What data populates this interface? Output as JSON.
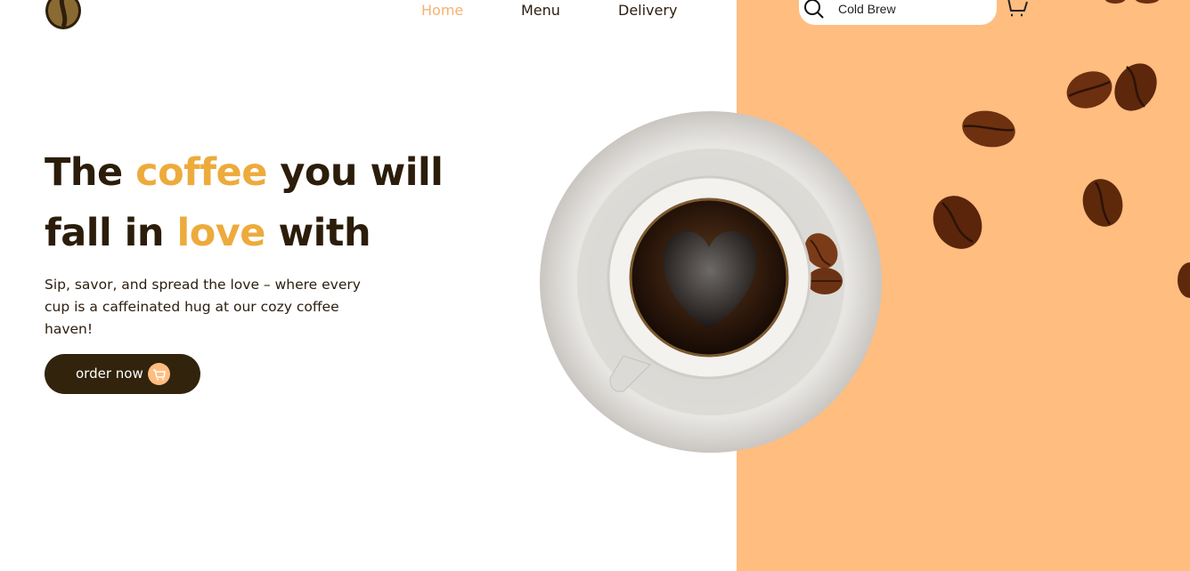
{
  "nav": {
    "items": [
      {
        "label": "Home",
        "active": true
      },
      {
        "label": "Menu",
        "active": false
      },
      {
        "label": "Delivery",
        "active": false
      }
    ]
  },
  "search": {
    "value": "Cold Brew",
    "icon": "search-icon"
  },
  "cart": {
    "icon": "cart-icon"
  },
  "hero": {
    "headline_line1": {
      "part1": "The ",
      "accent": "coffee",
      "part2": " you will"
    },
    "headline_line2": {
      "part1": "fall in ",
      "accent": "love",
      "part2": " with"
    },
    "subtext": "Sip, savor, and spread the love – where every cup is a caffeinated hug at our cozy coffee haven!",
    "order_button": {
      "label": "order now",
      "icon": "cart-icon"
    }
  },
  "colors": {
    "accent": "#edab3c",
    "panel": "#ffbd80",
    "dark": "#32230c",
    "nav_active": "#f6b170"
  }
}
